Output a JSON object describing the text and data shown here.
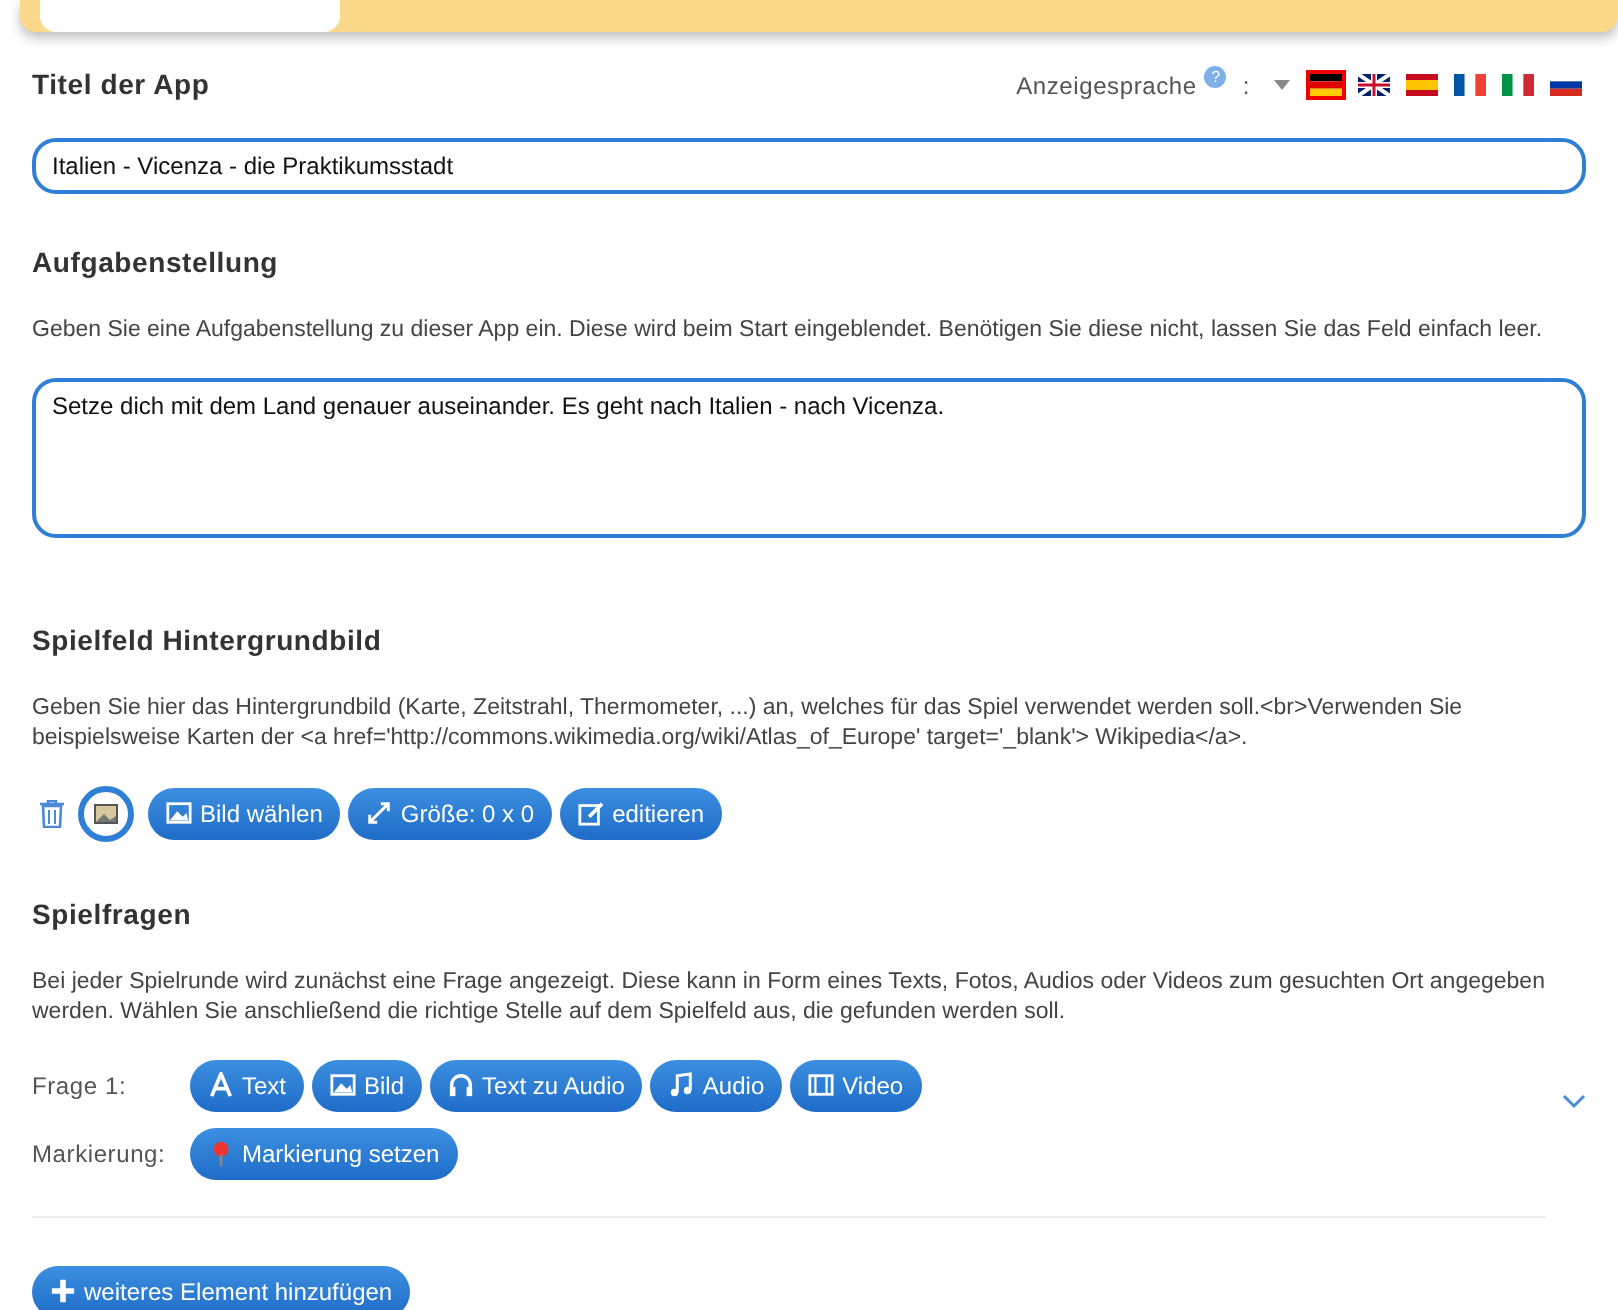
{
  "title_section": {
    "heading": "Titel der App",
    "language_label": "Anzeigesprache",
    "help": "?",
    "separator": ":",
    "languages": [
      {
        "kind": "de",
        "selected": true
      },
      {
        "kind": "en",
        "selected": false
      },
      {
        "kind": "es",
        "selected": false
      },
      {
        "kind": "fr",
        "selected": false
      },
      {
        "kind": "it",
        "selected": false
      },
      {
        "kind": "ru",
        "selected": false
      }
    ],
    "value": "Italien - Vicenza - die Praktikumsstadt"
  },
  "task_section": {
    "heading": "Aufgabenstellung",
    "description": "Geben Sie eine Aufgabenstellung zu dieser App ein. Diese wird beim Start eingeblendet. Benötigen Sie diese nicht, lassen Sie das Feld einfach leer.",
    "value": "Setze dich mit dem Land genauer auseinander. Es geht nach Italien - nach Vicenza."
  },
  "background_section": {
    "heading": "Spielfeld Hintergrundbild",
    "description": "Geben Sie hier das Hintergrundbild (Karte, Zeitstrahl, Thermometer, ...) an, welches für das Spiel verwendet werden soll.<br>Verwenden Sie beispielsweise Karten der <a href='http://commons.wikimedia.org/wiki/Atlas_of_Europe' target='_blank'> Wikipedia</a>.",
    "buttons": [
      {
        "kind": "image",
        "label": "Bild wählen"
      },
      {
        "kind": "resize",
        "label": "Größe: 0 x 0"
      },
      {
        "kind": "edit",
        "label": "editieren"
      }
    ]
  },
  "questions_section": {
    "heading": "Spielfragen",
    "description": "Bei jeder Spielrunde wird zunächst eine Frage angezeigt. Diese kann in Form eines Texts, Fotos, Audios oder Videos zum gesuchten Ort angegeben werden. Wählen Sie anschließend die richtige Stelle auf dem Spielfeld aus, die gefunden werden soll.",
    "question_label": "Frage 1:",
    "question_buttons": [
      {
        "kind": "text",
        "label": "Text"
      },
      {
        "kind": "image",
        "label": "Bild"
      },
      {
        "kind": "tts",
        "label": "Text zu Audio"
      },
      {
        "kind": "audio",
        "label": "Audio"
      },
      {
        "kind": "video",
        "label": "Video"
      }
    ],
    "marker_label": "Markierung:",
    "marker_button": "Markierung setzen"
  },
  "add_button": "weiteres Element hinzufügen"
}
